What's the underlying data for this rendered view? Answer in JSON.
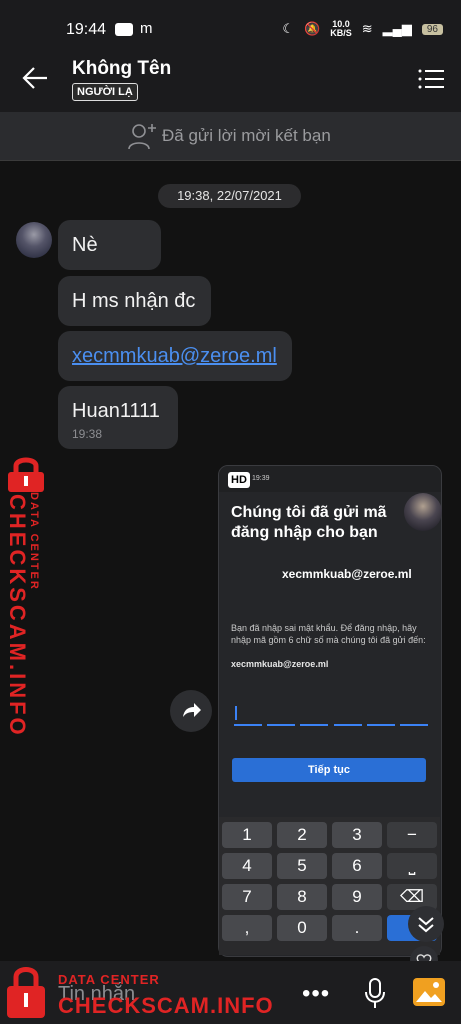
{
  "status": {
    "time": "19:44",
    "app_letter": "m",
    "speed_value": "10.0",
    "speed_unit": "KB/S",
    "battery": "96"
  },
  "header": {
    "title": "Không Tên",
    "badge": "NGƯỜI LẠ"
  },
  "friend_bar": {
    "text": "Đã gửi lời mời kết bạn"
  },
  "chat": {
    "date": "19:38, 22/07/2021",
    "messages": [
      {
        "text": "Nè"
      },
      {
        "text": "H ms nhận đc"
      },
      {
        "text": "xecmmkuab@zeroe.ml",
        "link": true
      },
      {
        "text": "Huan1111",
        "time": "19:38"
      }
    ]
  },
  "screenshot": {
    "hd": "HD",
    "time": "19:39",
    "title": "Chúng tôi đã gửi mã đăng nhập cho bạn",
    "email": "xecmmkuab@zeroe.ml",
    "description": "Bạn đã nhập sai mật khẩu. Để đăng nhập, hãy nhập mã gồm 6 chữ số mà chúng tôi đã gửi đến:",
    "description_email": "xecmmkuab@zeroe.ml",
    "continue_label": "Tiếp tục",
    "keys": [
      "1",
      "2",
      "3",
      "−",
      "4",
      "5",
      "6",
      "⎵",
      "7",
      "8",
      "9",
      "⌫",
      ",",
      "0",
      "."
    ]
  },
  "input": {
    "placeholder": "Tin nhắn"
  },
  "watermark": {
    "top": "DATA CENTER",
    "brand": "CHECKSCAM.INFO"
  },
  "colors": {
    "link": "#4b8ff0",
    "accent": "#2a6fd6",
    "watermark": "#e02424"
  }
}
